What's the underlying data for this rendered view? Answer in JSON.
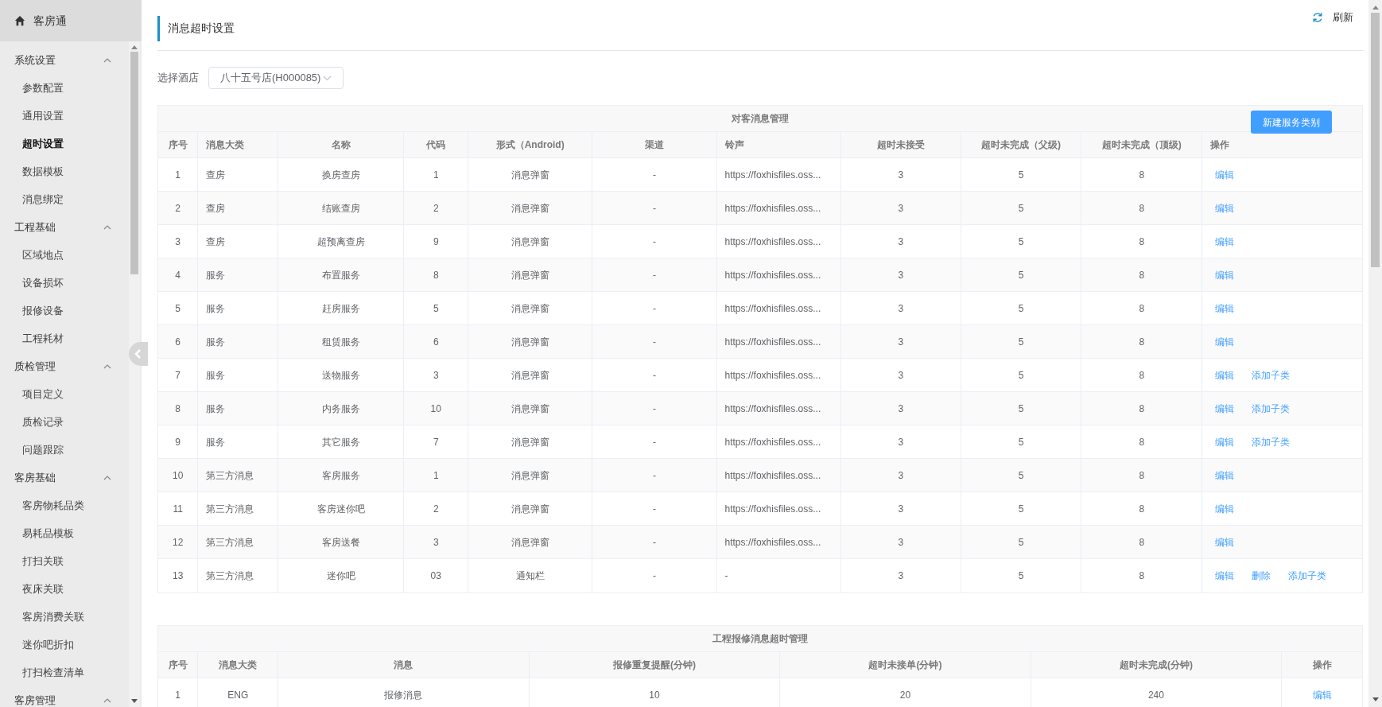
{
  "app": {
    "title": "客房通"
  },
  "sidebar": {
    "groups": [
      {
        "label": "系统设置",
        "expanded": true,
        "items": [
          {
            "label": "参数配置",
            "selected": false
          },
          {
            "label": "通用设置",
            "selected": false
          },
          {
            "label": "超时设置",
            "selected": true
          },
          {
            "label": "数据模板",
            "selected": false
          },
          {
            "label": "消息绑定",
            "selected": false
          }
        ]
      },
      {
        "label": "工程基础",
        "expanded": true,
        "items": [
          {
            "label": "区域地点",
            "selected": false
          },
          {
            "label": "设备损坏",
            "selected": false
          },
          {
            "label": "报修设备",
            "selected": false
          },
          {
            "label": "工程耗材",
            "selected": false
          }
        ]
      },
      {
        "label": "质检管理",
        "expanded": true,
        "items": [
          {
            "label": "项目定义",
            "selected": false
          },
          {
            "label": "质检记录",
            "selected": false
          },
          {
            "label": "问题跟踪",
            "selected": false
          }
        ]
      },
      {
        "label": "客房基础",
        "expanded": true,
        "items": [
          {
            "label": "客房物耗品类",
            "selected": false
          },
          {
            "label": "易耗品模板",
            "selected": false
          },
          {
            "label": "打扫关联",
            "selected": false
          },
          {
            "label": "夜床关联",
            "selected": false
          },
          {
            "label": "客房消费关联",
            "selected": false
          },
          {
            "label": "迷你吧折扣",
            "selected": false
          },
          {
            "label": "打扫检查清单",
            "selected": false
          }
        ]
      },
      {
        "label": "客房管理",
        "expanded": true
      }
    ]
  },
  "page": {
    "title": "消息超时设置",
    "refresh": "刷新"
  },
  "hotel_select": {
    "label": "选择酒店",
    "value": "八十五号店(H000085)"
  },
  "guest_table": {
    "title": "对客消息管理",
    "new_button": "新建服务类别",
    "columns": [
      "序号",
      "消息大类",
      "名称",
      "代码",
      "形式（Android)",
      "渠道",
      "铃声",
      "超时未接受",
      "超时未完成（父级)",
      "超时未完成（顶级)",
      "操作"
    ],
    "rows": [
      {
        "cells": [
          "1",
          "查房",
          "换房查房",
          "1",
          "消息弹窗",
          "-",
          "https://foxhisfiles.oss...",
          "3",
          "5",
          "8"
        ],
        "actions": [
          "编辑"
        ]
      },
      {
        "cells": [
          "2",
          "查房",
          "结账查房",
          "2",
          "消息弹窗",
          "-",
          "https://foxhisfiles.oss...",
          "3",
          "5",
          "8"
        ],
        "actions": [
          "编辑"
        ]
      },
      {
        "cells": [
          "3",
          "查房",
          "超预离查房",
          "9",
          "消息弹窗",
          "-",
          "https://foxhisfiles.oss...",
          "3",
          "5",
          "8"
        ],
        "actions": [
          "编辑"
        ]
      },
      {
        "cells": [
          "4",
          "服务",
          "布置服务",
          "8",
          "消息弹窗",
          "-",
          "https://foxhisfiles.oss...",
          "3",
          "5",
          "8"
        ],
        "actions": [
          "编辑"
        ]
      },
      {
        "cells": [
          "5",
          "服务",
          "赶房服务",
          "5",
          "消息弹窗",
          "-",
          "https://foxhisfiles.oss...",
          "3",
          "5",
          "8"
        ],
        "actions": [
          "编辑"
        ]
      },
      {
        "cells": [
          "6",
          "服务",
          "租赁服务",
          "6",
          "消息弹窗",
          "-",
          "https://foxhisfiles.oss...",
          "3",
          "5",
          "8"
        ],
        "actions": [
          "编辑"
        ]
      },
      {
        "cells": [
          "7",
          "服务",
          "送物服务",
          "3",
          "消息弹窗",
          "-",
          "https://foxhisfiles.oss...",
          "3",
          "5",
          "8"
        ],
        "actions": [
          "编辑",
          "添加子类"
        ]
      },
      {
        "cells": [
          "8",
          "服务",
          "内务服务",
          "10",
          "消息弹窗",
          "-",
          "https://foxhisfiles.oss...",
          "3",
          "5",
          "8"
        ],
        "actions": [
          "编辑",
          "添加子类"
        ]
      },
      {
        "cells": [
          "9",
          "服务",
          "其它服务",
          "7",
          "消息弹窗",
          "-",
          "https://foxhisfiles.oss...",
          "3",
          "5",
          "8"
        ],
        "actions": [
          "编辑",
          "添加子类"
        ]
      },
      {
        "cells": [
          "10",
          "第三方消息",
          "客房服务",
          "1",
          "消息弹窗",
          "-",
          "https://foxhisfiles.oss...",
          "3",
          "5",
          "8"
        ],
        "actions": [
          "编辑"
        ]
      },
      {
        "cells": [
          "11",
          "第三方消息",
          "客房迷你吧",
          "2",
          "消息弹窗",
          "-",
          "https://foxhisfiles.oss...",
          "3",
          "5",
          "8"
        ],
        "actions": [
          "编辑"
        ]
      },
      {
        "cells": [
          "12",
          "第三方消息",
          "客房送餐",
          "3",
          "消息弹窗",
          "-",
          "https://foxhisfiles.oss...",
          "3",
          "5",
          "8"
        ],
        "actions": [
          "编辑"
        ]
      },
      {
        "cells": [
          "13",
          "第三方消息",
          "迷你吧",
          "03",
          "通知栏",
          "-",
          "-",
          "3",
          "5",
          "8"
        ],
        "actions": [
          "编辑",
          "删除",
          "添加子类"
        ]
      }
    ]
  },
  "repair_table": {
    "title": "工程报修消息超时管理",
    "columns": [
      "序号",
      "消息大类",
      "消息",
      "报修重复提醒(分钟)",
      "超时未接单(分钟)",
      "超时未完成(分钟)",
      "操作"
    ],
    "rows": [
      {
        "cells": [
          "1",
          "ENG",
          "报修消息",
          "10",
          "20",
          "240"
        ],
        "actions": [
          "编辑"
        ]
      }
    ]
  }
}
